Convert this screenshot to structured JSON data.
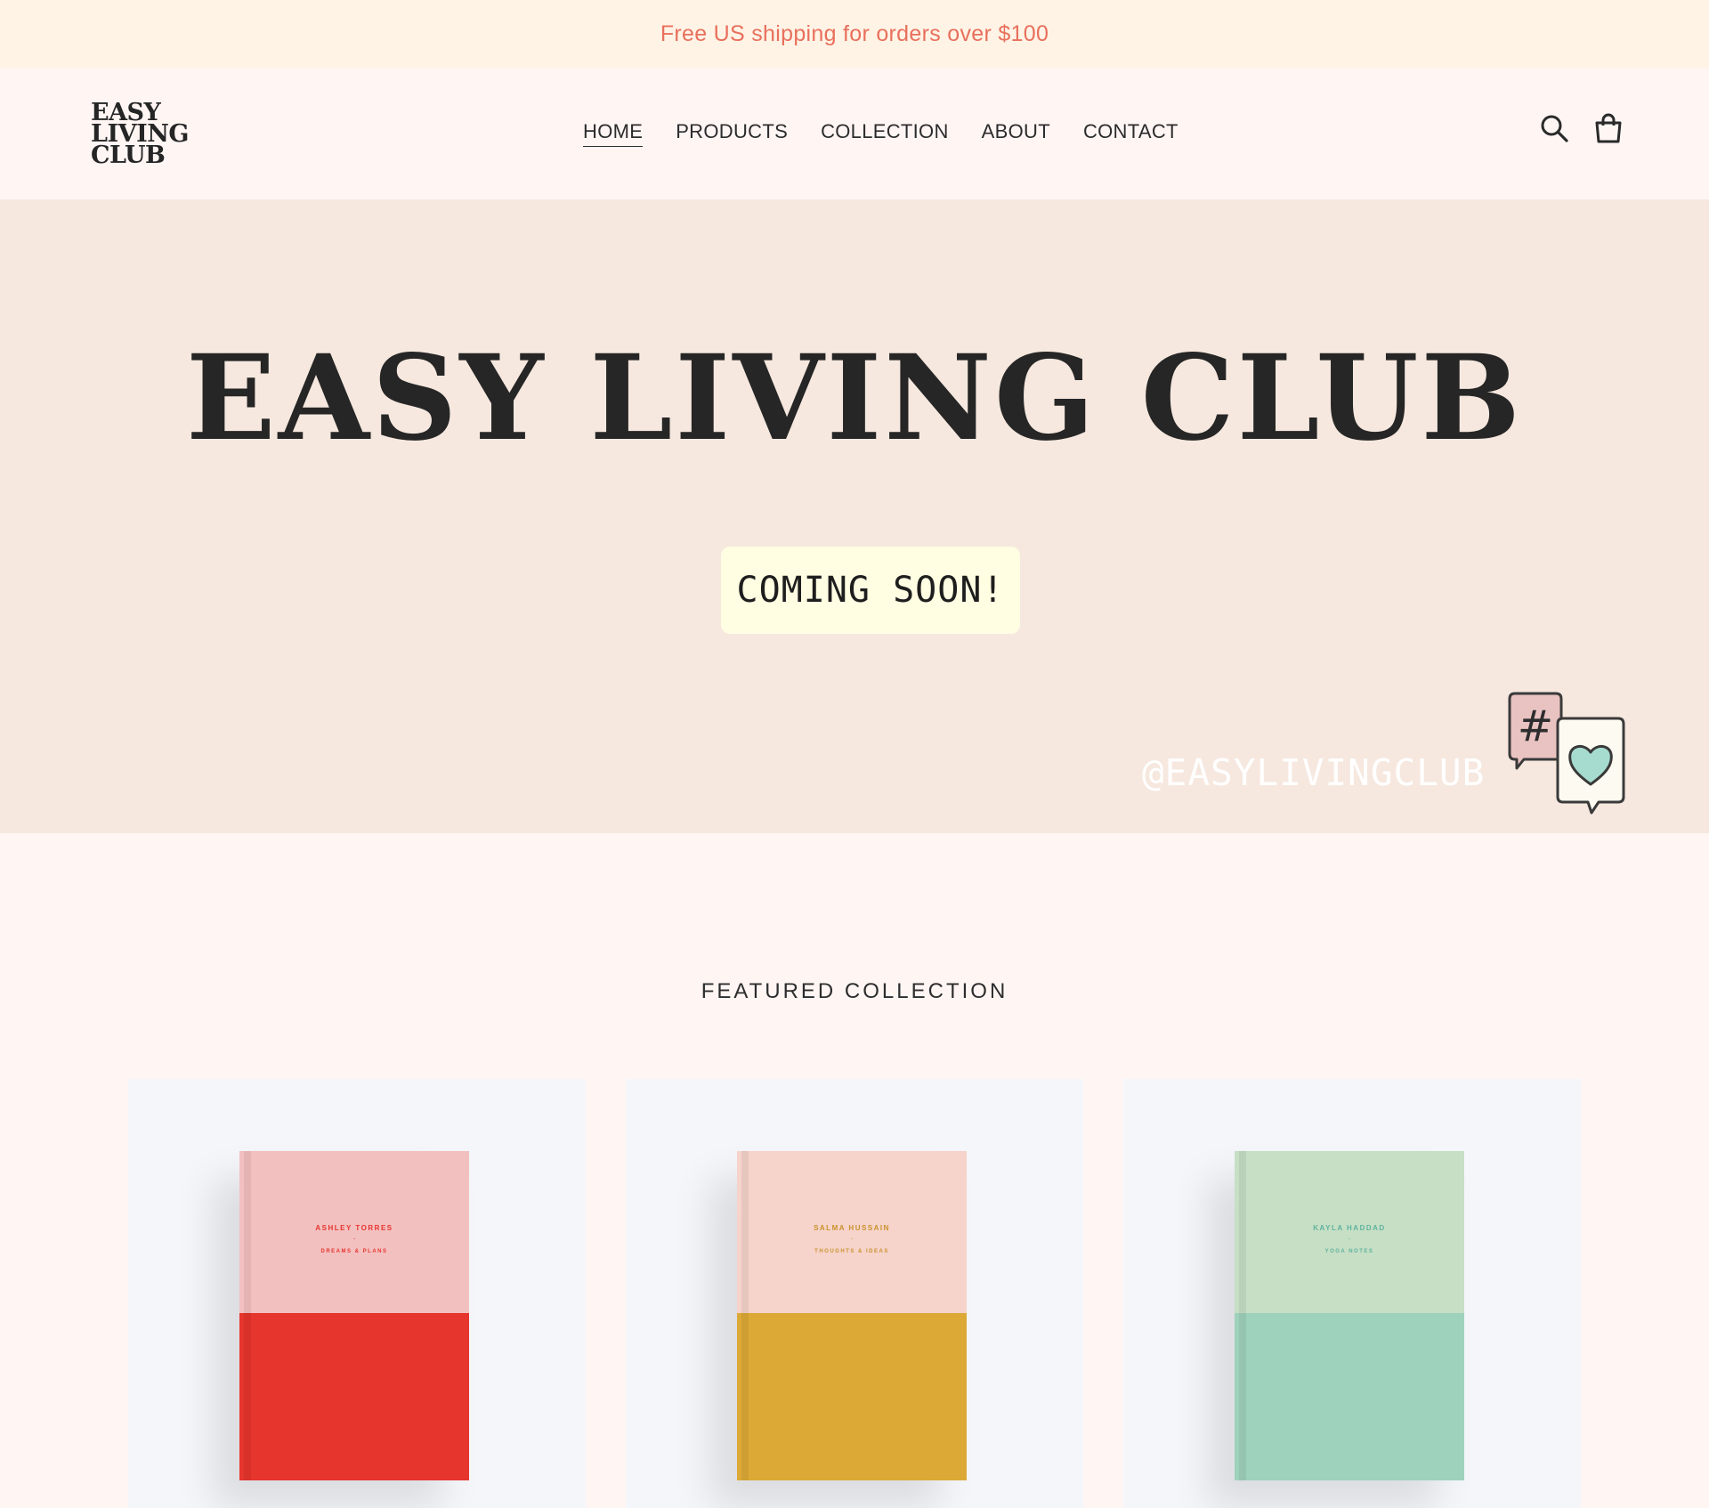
{
  "announcement": {
    "text": "Free US shipping for orders over $100",
    "color": "#e8705c"
  },
  "header": {
    "logo_lines": [
      "EASY",
      "LIVING",
      "CLUB"
    ],
    "nav": [
      {
        "label": "HOME",
        "active": true
      },
      {
        "label": "PRODUCTS",
        "active": false
      },
      {
        "label": "COLLECTION",
        "active": false
      },
      {
        "label": "ABOUT",
        "active": false
      },
      {
        "label": "CONTACT",
        "active": false
      }
    ],
    "icons": [
      "search-icon",
      "cart-icon"
    ]
  },
  "hero": {
    "title": "EASY LIVING CLUB",
    "cta": "COMING SOON!",
    "handle": "@EASYLIVINGCLUB",
    "bubble_icons": [
      "hashtag-bubble-icon",
      "heart-bubble-icon"
    ]
  },
  "featured": {
    "title": "FEATURED COLLECTION",
    "products": [
      {
        "name": "ASHLEY TORRES",
        "dash": "-",
        "subtitle": "DREAMS & PLANS",
        "top_color": "#f3c0c0",
        "bottom_color": "#e5352d",
        "text_color": "#e5352d"
      },
      {
        "name": "SALMA HUSSAIN",
        "dash": "-",
        "subtitle": "THOUGHTS & IDEAS",
        "top_color": "#f6d3cb",
        "bottom_color": "#dca937",
        "text_color": "#c9932c"
      },
      {
        "name": "KAYLA HADDAD",
        "dash": "-",
        "subtitle": "YOGA NOTES",
        "top_color": "#c6dfc5",
        "bottom_color": "#9fd2bd",
        "text_color": "#5fb39f"
      }
    ]
  },
  "colors": {
    "page_bg": "#fff6f4",
    "hero_bg": "#f6e8df",
    "announce_bg": "#fff3e6",
    "cta_bg": "#fffde2",
    "card_bg": "#f4f6fa",
    "text_dark": "#262626"
  }
}
